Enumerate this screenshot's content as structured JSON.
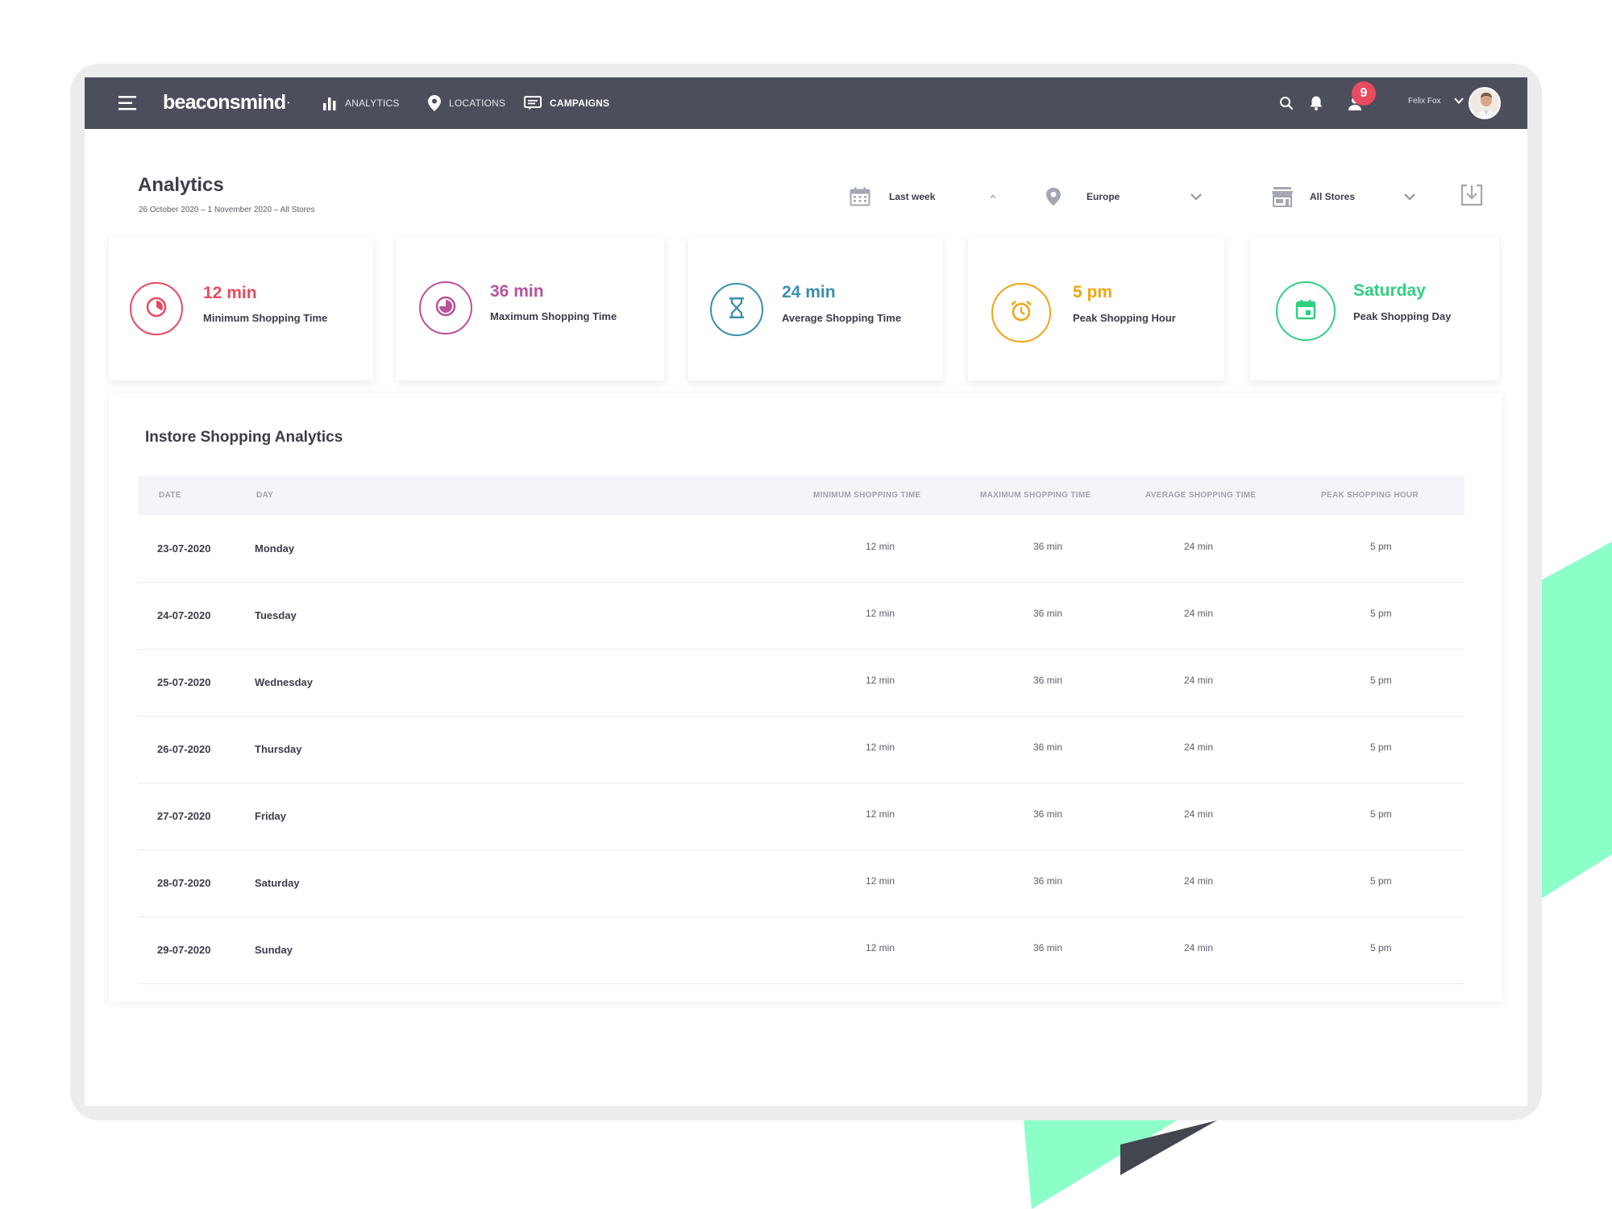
{
  "app": {
    "logo": "beaconsmind",
    "logo_mark": "•"
  },
  "nav": {
    "analytics": "ANALYTICS",
    "locations": "LOCATIONS",
    "campaigns": "CAMPAIGNS"
  },
  "user": {
    "name": "Felix Fox",
    "notifications": "9"
  },
  "header": {
    "title": "Analytics",
    "subtitle": "26 October 2020 – 1 November 2020 – All Stores"
  },
  "filters": {
    "date": "Last week",
    "location": "Europe",
    "store": "All Stores"
  },
  "kpis": [
    {
      "value": "12 min",
      "label": "Minimum Shopping Time",
      "color": "#e84a5f",
      "icon": "pie-clock-icon"
    },
    {
      "value": "36 min",
      "label": "Maximum Shopping Time",
      "color": "#b9539b",
      "icon": "pie-three-quarter-icon"
    },
    {
      "value": "24 min",
      "label": "Average Shopping Time",
      "color": "#3b8fb0",
      "icon": "hourglass-icon"
    },
    {
      "value": "5 pm",
      "label": "Peak Shopping Hour",
      "color": "#f2a413",
      "icon": "alarm-clock-icon"
    },
    {
      "value": "Saturday",
      "label": "Peak Shopping Day",
      "color": "#2fd07f",
      "icon": "calendar-icon"
    }
  ],
  "table": {
    "title": "Instore Shopping Analytics",
    "headers": [
      "DATE",
      "DAY",
      "MINIMUM SHOPPING TIME",
      "MAXIMUM SHOPPING TIME",
      "AVERAGE SHOPPING TIME",
      "PEAK SHOPPING HOUR"
    ],
    "rows": [
      {
        "date": "23-07-2020",
        "day": "Monday",
        "min": "12 min",
        "max": "36 min",
        "avg": "24 min",
        "peak": "5 pm"
      },
      {
        "date": "24-07-2020",
        "day": "Tuesday",
        "min": "12 min",
        "max": "36 min",
        "avg": "24 min",
        "peak": "5 pm"
      },
      {
        "date": "25-07-2020",
        "day": "Wednesday",
        "min": "12 min",
        "max": "36 min",
        "avg": "24 min",
        "peak": "5 pm"
      },
      {
        "date": "26-07-2020",
        "day": "Thursday",
        "min": "12 min",
        "max": "36 min",
        "avg": "24 min",
        "peak": "5 pm"
      },
      {
        "date": "27-07-2020",
        "day": "Friday",
        "min": "12 min",
        "max": "36 min",
        "avg": "24 min",
        "peak": "5 pm"
      },
      {
        "date": "28-07-2020",
        "day": "Saturday",
        "min": "12 min",
        "max": "36 min",
        "avg": "24 min",
        "peak": "5 pm"
      },
      {
        "date": "29-07-2020",
        "day": "Sunday",
        "min": "12 min",
        "max": "36 min",
        "avg": "24 min",
        "peak": "5 pm"
      }
    ]
  },
  "colors": {
    "navbar": "#4c4e5c",
    "accent_green": "#8cffc8",
    "badge": "#e84a5f"
  }
}
